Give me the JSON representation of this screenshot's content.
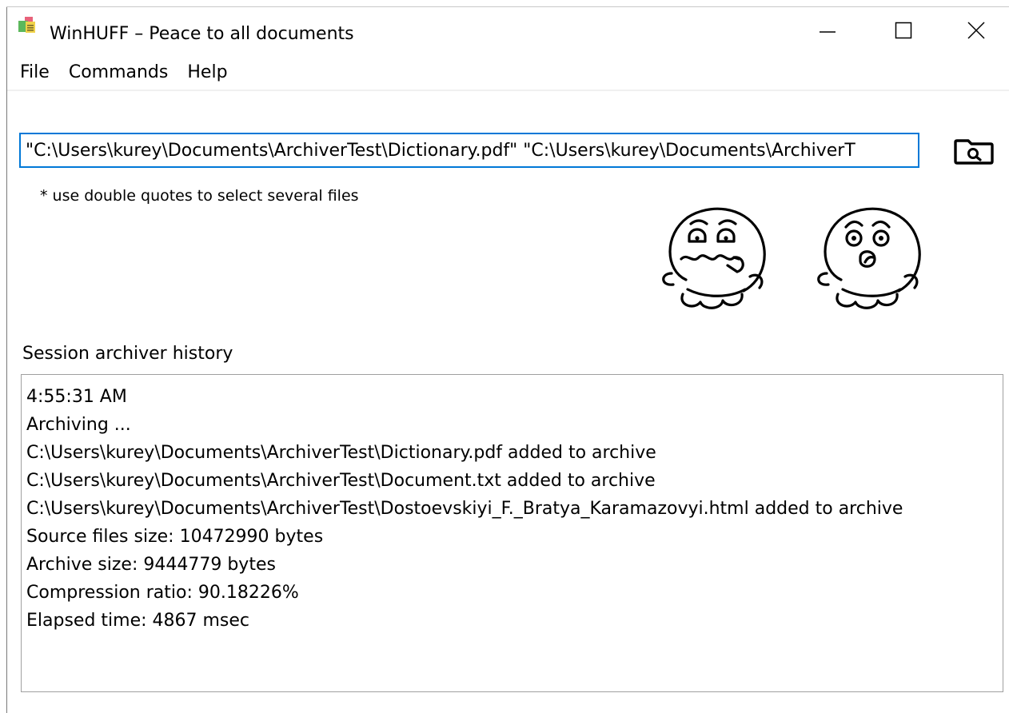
{
  "window": {
    "title": "WinHUFF – Peace to all documents",
    "icon": "winhuff-app-icon"
  },
  "menu": [
    "File",
    "Commands",
    "Help"
  ],
  "file_input": {
    "value": "\"C:\\Users\\kurey\\Documents\\ArchiverTest\\Dictionary.pdf\" \"C:\\Users\\kurey\\Documents\\ArchiverT",
    "hint": "* use double quotes to select several files",
    "browse_icon": "magnifier-folder-icon"
  },
  "mascots": [
    "worried-face-icon",
    "surprised-face-icon"
  ],
  "history": {
    "label": "Session archiver history",
    "lines": [
      "4:55:31 AM",
      "Archiving ...",
      "C:\\Users\\kurey\\Documents\\ArchiverTest\\Dictionary.pdf added to archive",
      "C:\\Users\\kurey\\Documents\\ArchiverTest\\Document.txt added to archive",
      "C:\\Users\\kurey\\Documents\\ArchiverTest\\Dostoevskiyi_F._Bratya_Karamazovyi.html added to archive",
      "Source files size: 10472990 bytes",
      "Archive size: 9444779 bytes",
      "Compression ratio: 90.18226%",
      "Elapsed time: 4867 msec"
    ]
  },
  "colors": {
    "accent_border": "#0078d7",
    "box_border": "#a0a0a0",
    "background": "#ffffff"
  }
}
